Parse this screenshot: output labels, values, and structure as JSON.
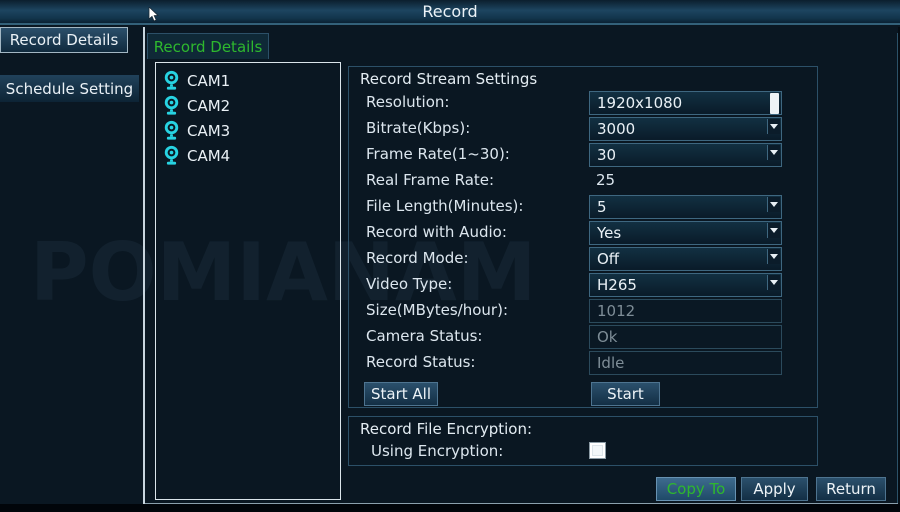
{
  "window": {
    "title": "Record"
  },
  "sidebar": {
    "items": [
      {
        "label": "Record Details",
        "selected": true
      },
      {
        "label": "Schedule Setting",
        "selected": false
      }
    ]
  },
  "tabs": [
    {
      "label": "Record Details",
      "active": true
    }
  ],
  "camera_list": [
    "CAM1",
    "CAM2",
    "CAM3",
    "CAM4"
  ],
  "stream_settings": {
    "title": "Record Stream Settings",
    "fields": [
      {
        "name": "resolution",
        "label": "Resolution:",
        "value": "1920x1080",
        "control": "combo-scroll"
      },
      {
        "name": "bitrate",
        "label": "Bitrate(Kbps):",
        "value": "3000",
        "control": "combo"
      },
      {
        "name": "frame-rate",
        "label": "Frame Rate(1~30):",
        "value": "30",
        "control": "combo"
      },
      {
        "name": "real-frame-rate",
        "label": "Real Frame Rate:",
        "value": "25",
        "control": "static"
      },
      {
        "name": "file-length",
        "label": "File Length(Minutes):",
        "value": "5",
        "control": "combo"
      },
      {
        "name": "record-audio",
        "label": "Record with Audio:",
        "value": "Yes",
        "control": "combo"
      },
      {
        "name": "record-mode",
        "label": "Record Mode:",
        "value": "Off",
        "control": "combo"
      },
      {
        "name": "video-type",
        "label": "Video Type:",
        "value": "H265",
        "control": "combo"
      },
      {
        "name": "size",
        "label": "Size(MBytes/hour):",
        "value": "1012",
        "control": "disabled"
      },
      {
        "name": "camera-status",
        "label": "Camera Status:",
        "value": "Ok",
        "control": "disabled"
      },
      {
        "name": "record-status",
        "label": "Record Status:",
        "value": "Idle",
        "control": "disabled"
      }
    ],
    "start_all_label": "Start All",
    "start_label": "Start"
  },
  "encryption": {
    "title": "Record File Encryption:",
    "using_label": "Using Encryption:",
    "checked": false
  },
  "footer": {
    "copy_to": "Copy To",
    "apply": "Apply",
    "return": "Return"
  },
  "watermark": "POMIANAM",
  "colors": {
    "accent_green": "#2eb82e",
    "camera_cyan": "#27d3e2",
    "panel_border": "#2c5068",
    "background": "#0a1722"
  }
}
